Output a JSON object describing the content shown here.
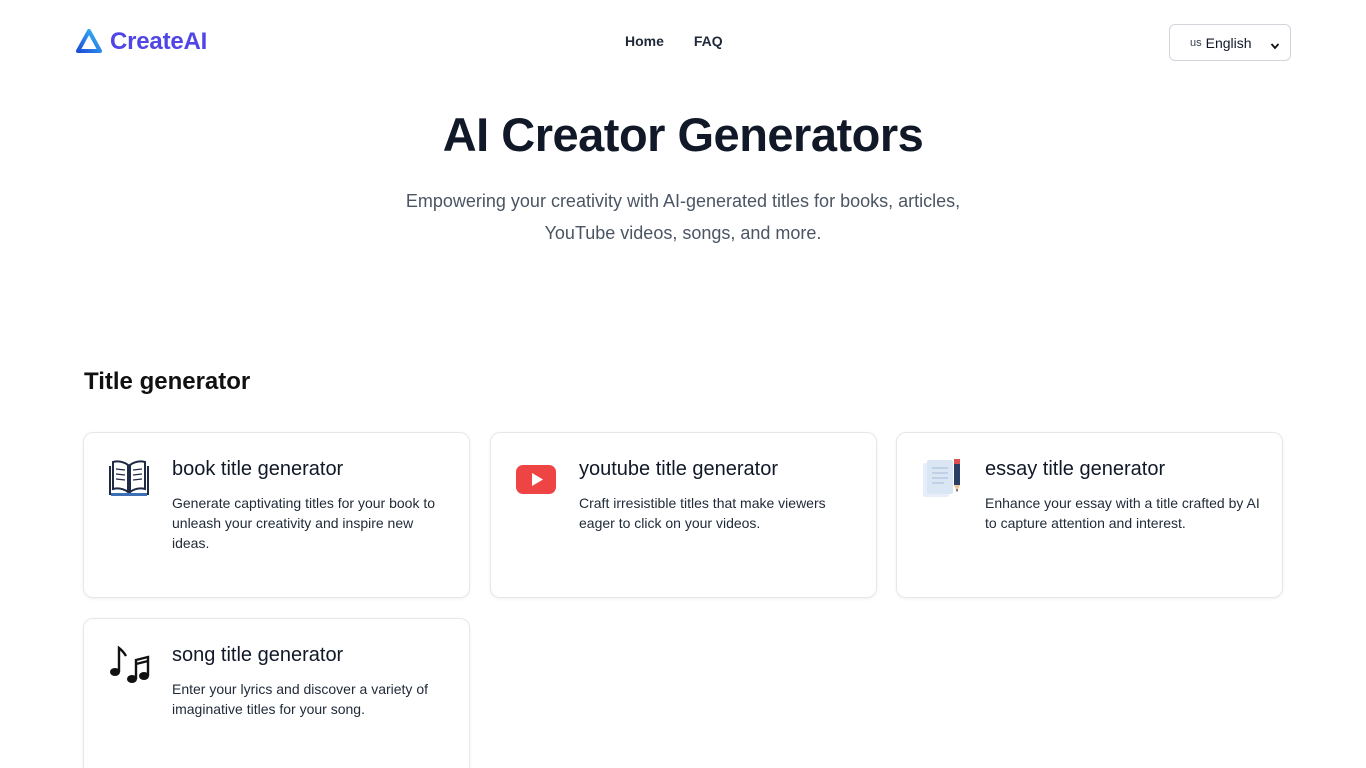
{
  "header": {
    "logo_text": "CreateAI",
    "logo_icon": "triangle-logo-icon",
    "nav": [
      {
        "label": "Home"
      },
      {
        "label": "FAQ"
      }
    ],
    "language": {
      "flag": "us",
      "label": "English"
    }
  },
  "hero": {
    "title": "AI Creator Generators",
    "subtitle": "Empowering your creativity with AI-generated titles for books, articles, YouTube videos, songs, and more."
  },
  "section": {
    "title": "Title generator",
    "cards": [
      {
        "title": "book title generator",
        "description": "Generate captivating titles for your book to unleash your creativity and inspire new ideas.",
        "icon": "open-book-icon"
      },
      {
        "title": "youtube title generator",
        "description": "Craft irresistible titles that make viewers eager to click on your videos.",
        "icon": "youtube-play-icon"
      },
      {
        "title": "essay title generator",
        "description": "Enhance your essay with a title crafted by AI to capture attention and interest.",
        "icon": "document-pencil-icon"
      },
      {
        "title": "song title generator",
        "description": "Enter your lyrics and discover a variety of imaginative titles for your song.",
        "icon": "music-notes-icon"
      }
    ]
  },
  "colors": {
    "brand": "#4f46e5",
    "logo_gradient_start": "#2563eb",
    "logo_gradient_end": "#38bdf8",
    "youtube_red": "#ef4444"
  }
}
